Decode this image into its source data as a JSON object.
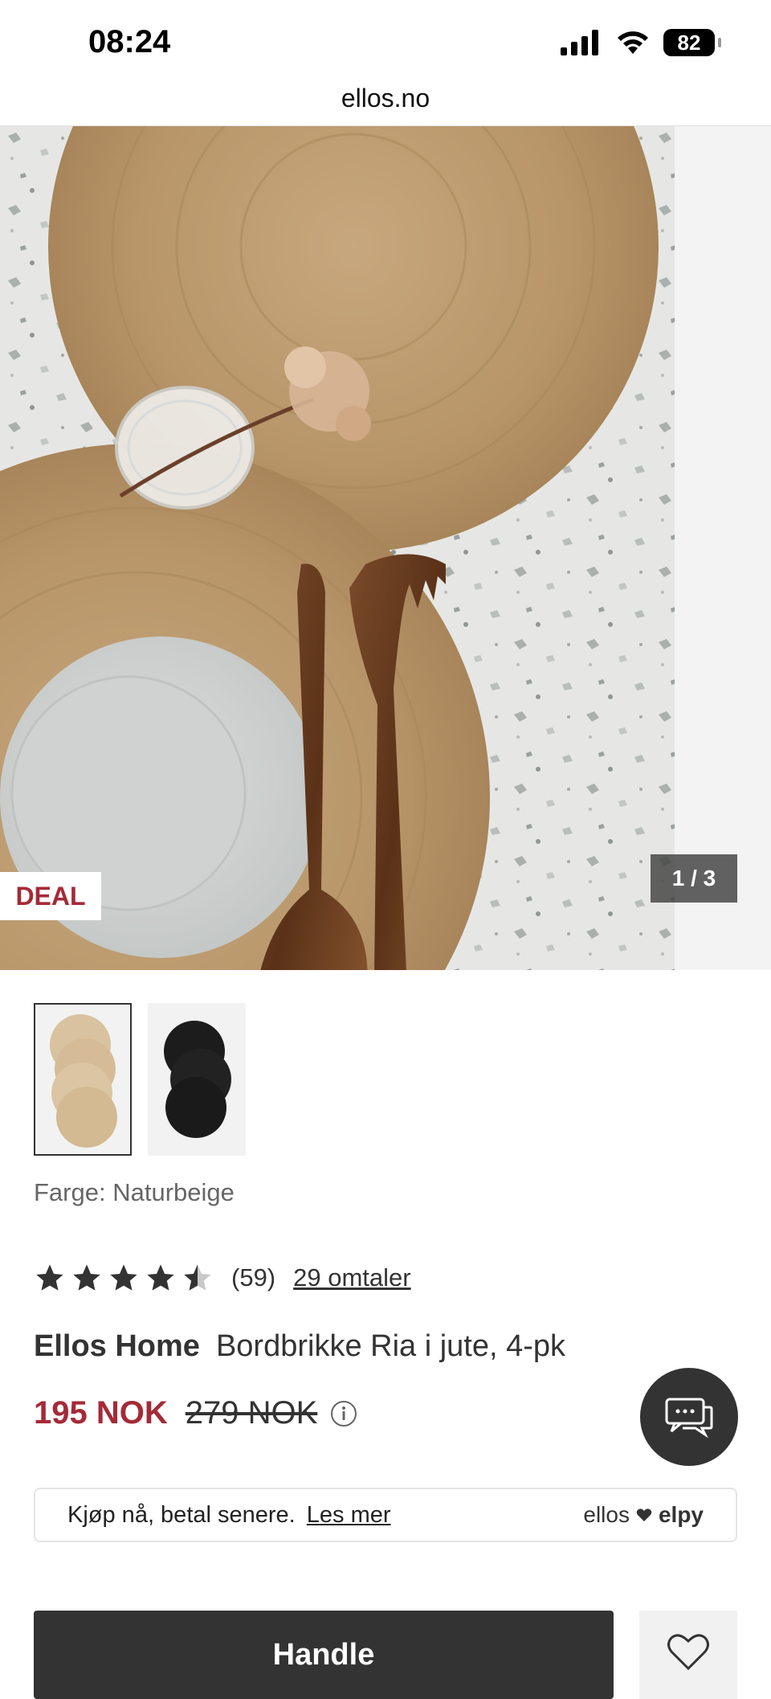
{
  "status_bar": {
    "time": "08:24",
    "battery": "82"
  },
  "browser": {
    "url": "ellos.no"
  },
  "gallery": {
    "deal_badge": "DEAL",
    "counter": "1 / 3"
  },
  "variant": {
    "color_label": "Farge: Naturbeige"
  },
  "rating": {
    "value_stars": 4.5,
    "count": "(59)",
    "reviews_link": "29 omtaler"
  },
  "product": {
    "brand": "Ellos Home",
    "name": "Bordbrikke Ria i jute, 4-pk"
  },
  "price": {
    "now": "195 NOK",
    "old": "279 NOK"
  },
  "bnpl": {
    "text": "Kjøp nå, betal senere.",
    "link": "Les mer",
    "logo_left": "ellos",
    "logo_right": "elpy"
  },
  "actions": {
    "buy": "Handle"
  },
  "colors": {
    "deal_red": "#a52a37",
    "dark": "#333333"
  }
}
